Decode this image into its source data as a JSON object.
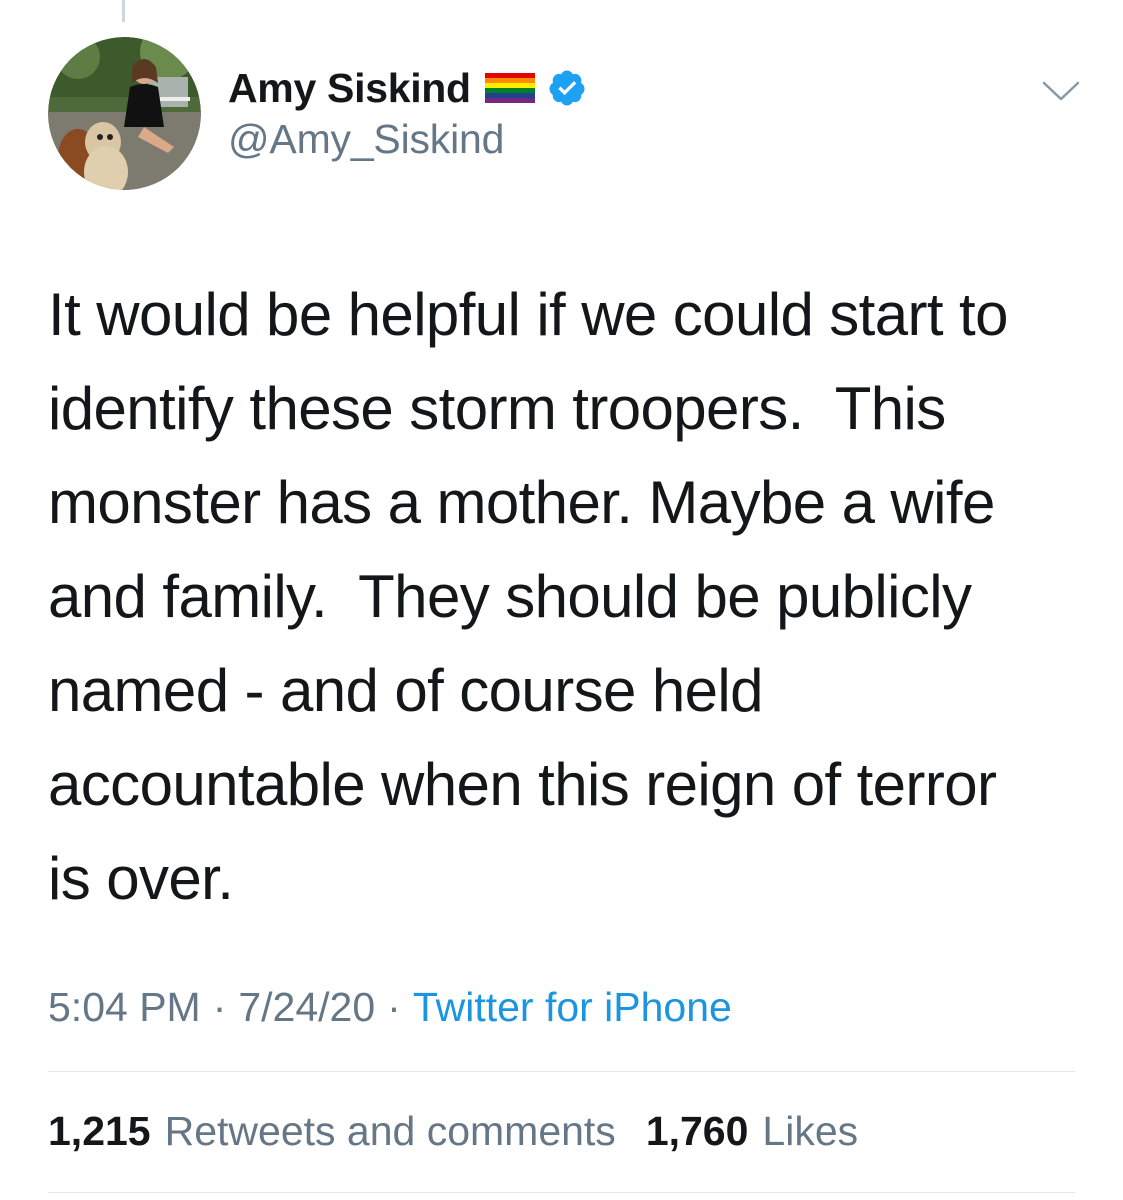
{
  "tweet": {
    "author": {
      "display_name": "Amy Siskind",
      "handle": "@Amy_Siskind",
      "badges": [
        "rainbow-flag-icon",
        "verified-icon"
      ]
    },
    "text": "It would be helpful if we could start to\nidentify these storm troopers.  This\nmonster has a mother. Maybe a wife\nand family.  They should be publicly\nnamed - and of course held\naccountable when this reign of terror\nis over.",
    "time": "5:04 PM",
    "date": "7/24/20",
    "separator": "·",
    "source": "Twitter for iPhone",
    "stats": {
      "retweets_count": "1,215",
      "retweets_label": "Retweets and comments",
      "likes_count": "1,760",
      "likes_label": "Likes"
    }
  },
  "colors": {
    "text_primary": "#14171a",
    "text_secondary": "#657786",
    "link": "#1b95e0",
    "verified": "#1da1f2",
    "divider": "#e1e8ed"
  },
  "icons": {
    "menu": "chevron-down-icon"
  }
}
